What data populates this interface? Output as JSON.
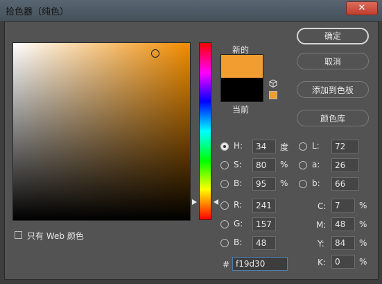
{
  "window": {
    "title": "拾色器（纯色）",
    "close_glyph": "✕"
  },
  "preview": {
    "new_label": "新的",
    "current_label": "当前",
    "new_color": "#f19d30",
    "current_color": "#000000"
  },
  "buttons": {
    "ok": "确定",
    "cancel": "取消",
    "add_to_swatches": "添加到色板",
    "color_libraries": "颜色库"
  },
  "web_only_label": "只有 Web 颜色",
  "hsb": {
    "h": {
      "label": "H:",
      "value": "34",
      "unit": "度"
    },
    "s": {
      "label": "S:",
      "value": "80",
      "unit": "%"
    },
    "b": {
      "label": "B:",
      "value": "95",
      "unit": "%"
    }
  },
  "rgb": {
    "r": {
      "label": "R:",
      "value": "241"
    },
    "g": {
      "label": "G:",
      "value": "157"
    },
    "b": {
      "label": "B:",
      "value": "48"
    }
  },
  "lab": {
    "l": {
      "label": "L:",
      "value": "72"
    },
    "a": {
      "label": "a:",
      "value": "26"
    },
    "b": {
      "label": "b:",
      "value": "66"
    }
  },
  "cmyk": {
    "c": {
      "label": "C:",
      "value": "7",
      "unit": "%"
    },
    "m": {
      "label": "M:",
      "value": "48",
      "unit": "%"
    },
    "y": {
      "label": "Y:",
      "value": "84",
      "unit": "%"
    },
    "k": {
      "label": "K:",
      "value": "0",
      "unit": "%"
    }
  },
  "hex": {
    "label": "#",
    "value": "f19d30"
  },
  "selected_mode": "H"
}
